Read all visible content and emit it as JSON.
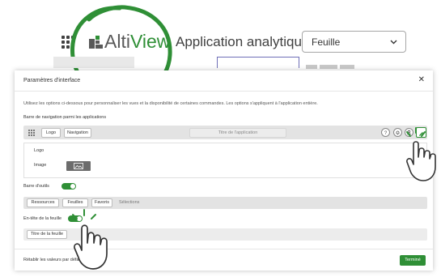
{
  "header": {
    "logo_part1": "Alti",
    "logo_part2": "View",
    "app_title": "Application analytique",
    "sheet_selector": "Feuille"
  },
  "dialog": {
    "title": "Paramètres d'interface",
    "description": "Utilisez les options ci-dessous pour personnaliser les vues et la disponibilité de certaines commandes. Les options s'appliquent à l'application entière.",
    "nav_section_label": "Barre de navigation parmi les applications",
    "nav_chips": [
      "Logo",
      "Navigation"
    ],
    "app_title_chip": "Titre de l'application",
    "panel": {
      "logo_label": "Logo",
      "image_label": "Image"
    },
    "toolbar_label": "Barre d'outils",
    "toolbar_chips": [
      "Ressources",
      "Feuilles",
      "Favoris"
    ],
    "toolbar_selections": "Sélections",
    "sheet_header_label": "En-tête de la feuille",
    "sheet_title_chip": "Titre de la feuille",
    "reset_button": "Rétablir les valeurs par défaut",
    "done_button": "Terminé",
    "close_glyph": "✕"
  },
  "toggles": {
    "toolbar_enabled": true,
    "sheet_header_enabled": true
  },
  "colors": {
    "brand_green": "#2f8f36",
    "logo_gray": "#595959",
    "accent_blue": "#6f6fb7"
  },
  "icons": [
    "grid-icon",
    "chevron-down-icon",
    "close-icon",
    "help-icon",
    "bell-icon",
    "user-icon",
    "edit-icon",
    "image-icon",
    "pointing-hand-icon"
  ]
}
